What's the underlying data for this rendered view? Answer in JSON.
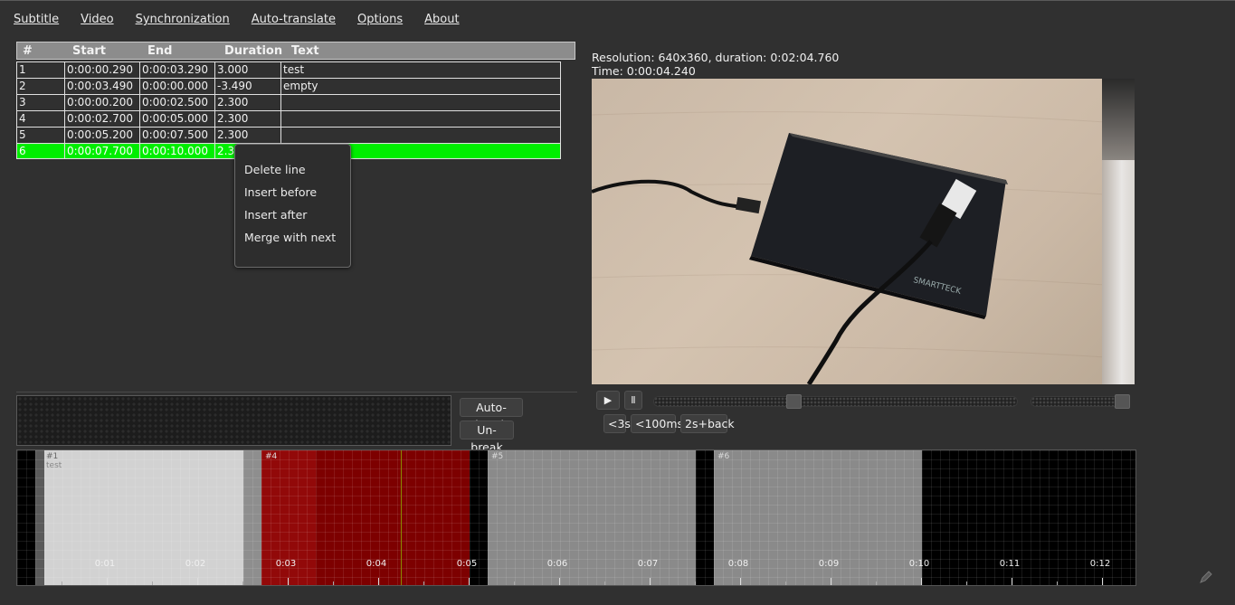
{
  "menu": [
    "Subtitle",
    "Video",
    "Synchronization",
    "Auto-translate",
    "Options",
    "About"
  ],
  "table": {
    "headers": [
      "#",
      "Start",
      "End",
      "Duration",
      "Text"
    ],
    "rows": [
      [
        "1",
        "0:00:00.290",
        "0:00:03.290",
        "3.000",
        "test"
      ],
      [
        "2",
        "0:00:03.490",
        "0:00:00.000",
        "-3.490",
        "empty"
      ],
      [
        "3",
        "0:00:00.200",
        "0:00:02.500",
        "2.300",
        ""
      ],
      [
        "4",
        "0:00:02.700",
        "0:00:05.000",
        "2.300",
        ""
      ],
      [
        "5",
        "0:00:05.200",
        "0:00:07.500",
        "2.300",
        ""
      ],
      [
        "6",
        "0:00:07.700",
        "0:00:10.000",
        "2.300",
        ""
      ]
    ],
    "selected_row": 6,
    "selected_color": "#00ee00"
  },
  "context_menu": [
    "Delete line",
    "Insert before",
    "Insert after",
    "Merge with next"
  ],
  "editor": {
    "auto_break": "Auto-break",
    "un_break": "Un-break"
  },
  "video": {
    "resolution_line": "Resolution: 640x360, duration: 0:02:04.760",
    "time_line": "Time: 0:00:04.240",
    "play_icon": "play-icon",
    "pause_icon": "pause-icon",
    "back3": "<3s",
    "back100": "<100ms",
    "twoback": "2s+back",
    "seek_position": 0.38,
    "volume_level": 1.0
  },
  "timeline": {
    "segments": [
      {
        "id": "#1",
        "label": "#1",
        "text": "test",
        "color": "#d2d2d2"
      },
      {
        "id": "#4",
        "label": "#4",
        "text": "",
        "color": "#8b0000"
      },
      {
        "id": "#5",
        "label": "#5",
        "text": "",
        "color": "#8a8a8a"
      },
      {
        "id": "#6",
        "label": "#6",
        "text": "",
        "color": "#8a8a8a"
      }
    ],
    "ticks": [
      "0:01",
      "0:02",
      "0:03",
      "0:04",
      "0:05",
      "0:06",
      "0:07",
      "0:08",
      "0:09",
      "0:10",
      "0:11",
      "0:12"
    ]
  },
  "corner_icon": "pen-icon"
}
